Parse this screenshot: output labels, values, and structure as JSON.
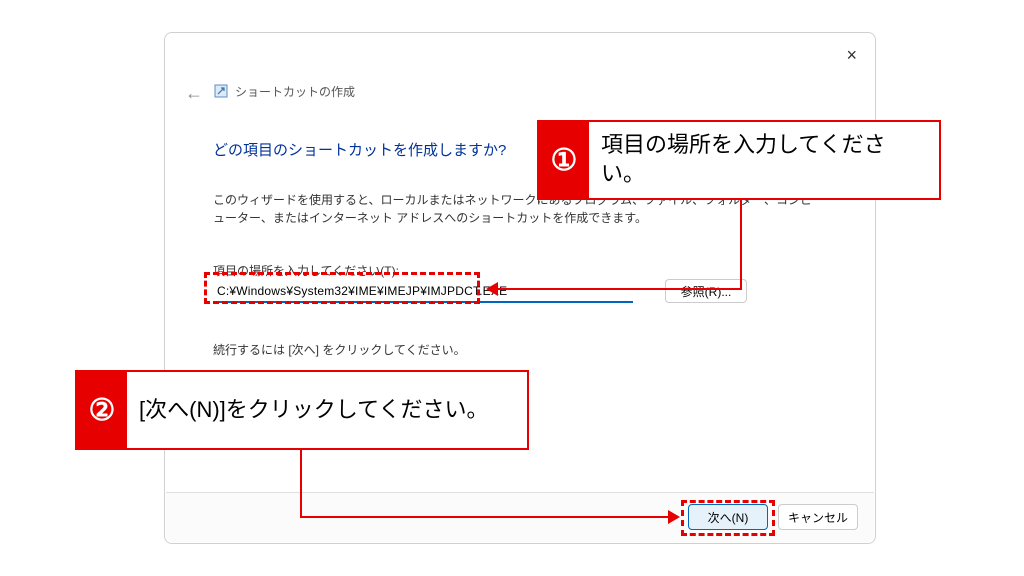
{
  "dialog": {
    "title": "ショートカットの作成",
    "close": "×",
    "heading": "どの項目のショートカットを作成しますか?",
    "description": "このウィザードを使用すると、ローカルまたはネットワークにあるプログラム、ファイル、フォルダー、コンピューター、またはインターネット アドレスへのショートカットを作成できます。",
    "field_label": "項目の場所を入力してください(T):",
    "path_value": "C:¥Windows¥System32¥IME¥IMEJP¥IMJPDCT.EXE",
    "browse_label": "参照(R)...",
    "continue_text": "続行するには [次へ] をクリックしてください。",
    "next_label": "次へ(N)",
    "cancel_label": "キャンセル"
  },
  "annotations": {
    "step1_badge": "①",
    "step1_text": "項目の場所を入力してください。",
    "step2_badge": "②",
    "step2_text": "[次へ(N)]をクリックしてください。"
  }
}
